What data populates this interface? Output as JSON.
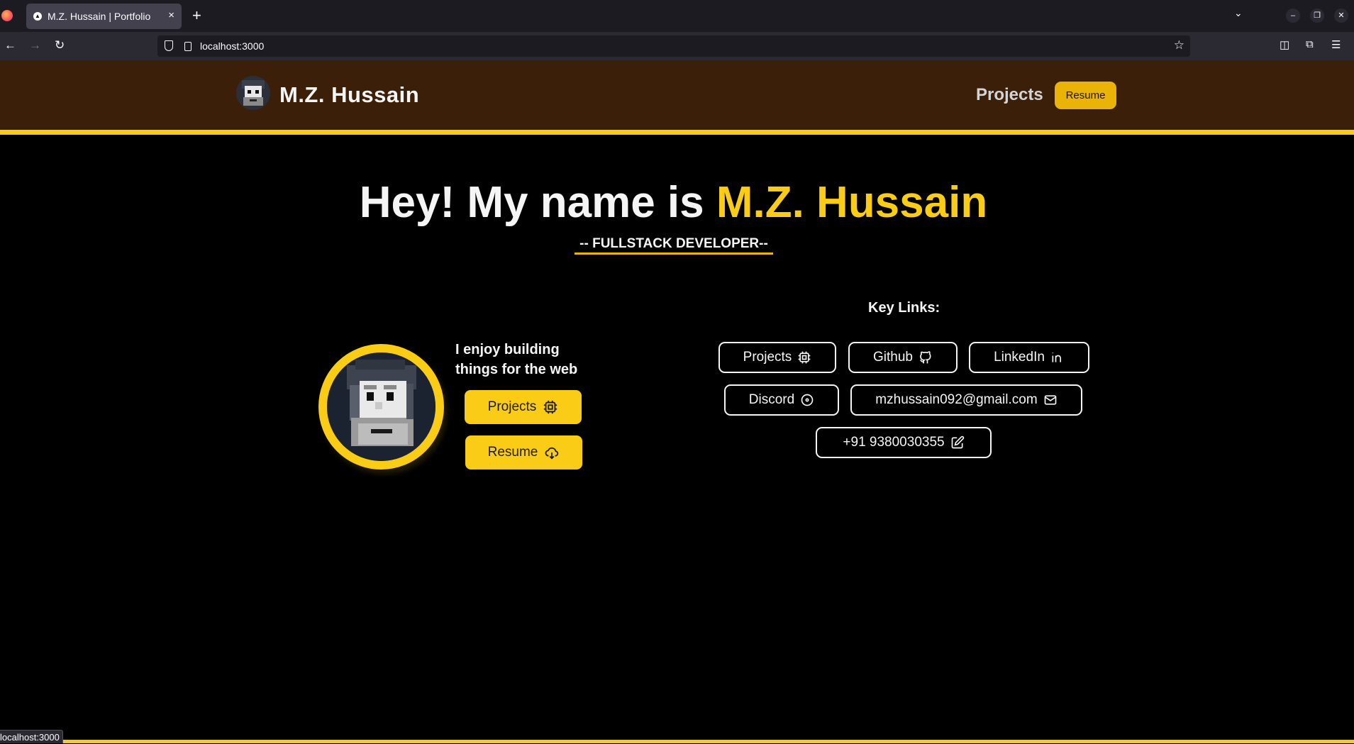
{
  "browser": {
    "tab_title": "M.Z. Hussain | Portfolio",
    "tab_close": "×",
    "new_tab": "+",
    "url": "localhost:3000",
    "status_url": "localhost:3000"
  },
  "header": {
    "brand": "M.Z. Hussain",
    "nav_projects": "Projects",
    "nav_resume": "Resume"
  },
  "hero": {
    "title_prefix": "Hey! My name is ",
    "title_name": "M.Z. Hussain",
    "subtitle": "-- FULLSTACK DEVELOPER--"
  },
  "intro": {
    "tagline": "I enjoy building things for the web",
    "projects_button": "Projects",
    "resume_button": "Resume"
  },
  "key_links": {
    "title": "Key Links:",
    "items": [
      {
        "label": "Projects",
        "icon": "cpu-icon"
      },
      {
        "label": "Github",
        "icon": "github-icon"
      },
      {
        "label": "LinkedIn",
        "icon": "linkedin-icon"
      },
      {
        "label": "Discord",
        "icon": "disc-icon"
      },
      {
        "label": "mzhussain092@gmail.com",
        "icon": "mail-icon"
      },
      {
        "label": "+91 9380030355",
        "icon": "edit-icon"
      }
    ]
  },
  "colors": {
    "accent": "#facc15",
    "header_bg": "#3c1f08",
    "background": "#000000"
  }
}
